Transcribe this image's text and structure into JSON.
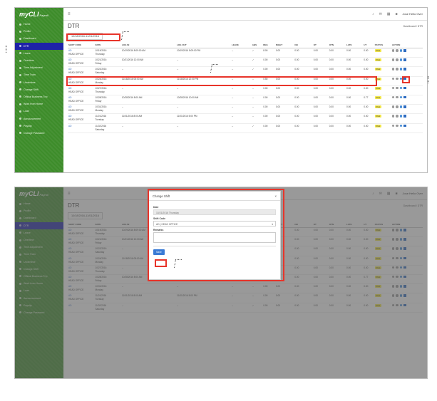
{
  "app": {
    "logo_text": "myCLI",
    "logo_sub": "Payroll",
    "user_name": "Jose Hello Over"
  },
  "sidebar": {
    "items": [
      {
        "label": "Home"
      },
      {
        "label": "Profile"
      },
      {
        "label": "Dashboard"
      },
      {
        "label": "DTR"
      },
      {
        "label": "Leave"
      },
      {
        "label": "Overtime"
      },
      {
        "label": "Time Adjustment"
      },
      {
        "label": "Time Train"
      },
      {
        "label": "Undertime"
      },
      {
        "label": "Change Shift"
      },
      {
        "label": "Official Business Trip"
      },
      {
        "label": "Work from Home"
      },
      {
        "label": "Loan"
      },
      {
        "label": "Announcement"
      },
      {
        "label": "Payslip"
      },
      {
        "label": "Change Password"
      }
    ]
  },
  "page": {
    "title": "DTR",
    "breadcrumb": "Dashboard / DTR",
    "date_range": "10/18/2016-11/01/2016"
  },
  "table": {
    "headers": [
      "SHIFT CODE",
      "DATE",
      "LOG IN",
      "LOG OUT",
      "LEAVE",
      "ABS",
      "REG",
      "NIGHT",
      "OB",
      "OT",
      "OTN",
      "LATE",
      "UT",
      "STATUS",
      "ACTION"
    ],
    "rows": [
      {
        "shift": "AD",
        "office": "HEAD OFFICE",
        "date": "10/19/2016",
        "day": "Thursday",
        "login": "10/19/2016 8:09:00 AM",
        "login_pink": true,
        "logout": "10/19/2016 5:09:00 PM",
        "logout_pink": true,
        "leave": "--",
        "abs": "✓",
        "reg": "8.00",
        "night": "0.00",
        "ob": "0.00",
        "ot": "0.00",
        "otn": "0.00",
        "late": "0.00",
        "ut": "0.00",
        "status": "Post"
      },
      {
        "shift": "AD",
        "office": "HEAD OFFICE",
        "date": "10/21/2016",
        "day": "Friday",
        "login": "10/21/2016 12:00 AM",
        "login_pink": false,
        "logout": "--",
        "logout_pink": false,
        "leave": "--",
        "abs": "✓",
        "reg": "0.00",
        "night": "0.00",
        "ob": "0.00",
        "ot": "0.00",
        "otn": "0.00",
        "late": "0.00",
        "ut": "0.00",
        "status": "Post"
      },
      {
        "shift": "AD",
        "office": "HEAD OFFICE",
        "date": "10/22/2016",
        "day": "Saturday",
        "login": "--",
        "login_pink": false,
        "logout": "--",
        "logout_pink": false,
        "leave": "--",
        "abs": "✓",
        "reg": "0.00",
        "night": "0.00",
        "ob": "0.00",
        "ot": "0.00",
        "otn": "0.00",
        "late": "0.00",
        "ut": "0.00",
        "status": "Post"
      },
      {
        "shift": "AD",
        "office": "HEAD OFFICE",
        "date": "10/24/2016",
        "day": "Monday",
        "login": "11/18/2016 08:00 AM",
        "login_pink": false,
        "logout": "11/18/2016 12:00 PM",
        "logout_pink": false,
        "leave": "--",
        "abs": "--",
        "reg": "0.50",
        "night": "0.00",
        "ob": "0.00",
        "ot": "0.00",
        "otn": "0.00",
        "late": "0.00",
        "ut": "0.00",
        "status": "Post"
      },
      {
        "shift": "AD",
        "office": "HEAD OFFICE",
        "date": "10/27/2016",
        "day": "Thursday",
        "login": "--",
        "login_pink": false,
        "logout": "--",
        "logout_pink": false,
        "leave": "--",
        "abs": "--",
        "reg": "0.00",
        "night": "0.00",
        "ob": "0.00",
        "ot": "0.00",
        "otn": "0.00",
        "late": "0.00",
        "ut": "0.00",
        "status": "Post"
      },
      {
        "shift": "AD",
        "office": "HEAD OFFICE",
        "date": "10/28/2016",
        "day": "Friday",
        "login": "10/28/2016 8:00 AM",
        "login_pink": false,
        "logout": "10/28/2016 10:00 AM",
        "logout_pink": false,
        "leave": "--",
        "abs": "--",
        "reg": "0.00",
        "night": "0.00",
        "ob": "0.00",
        "ot": "0.00",
        "otn": "0.00",
        "late": "0.00",
        "ut": "0.77",
        "status": "Post",
        "ut_red": true
      },
      {
        "shift": "AD",
        "office": "HEAD OFFICE",
        "date": "10/31/2016",
        "day": "Monday",
        "login": "--",
        "login_pink": false,
        "logout": "--",
        "logout_pink": false,
        "leave": "--",
        "abs": "--",
        "reg": "0.00",
        "night": "0.00",
        "ob": "0.00",
        "ot": "0.00",
        "otn": "0.00",
        "late": "0.00",
        "ut": "0.00",
        "status": "Post"
      },
      {
        "shift": "AD",
        "office": "HEAD OFFICE",
        "date": "11/01/2016",
        "day": "Tuesday",
        "login": "11/01/2016 8:00 AM",
        "login_pink": false,
        "logout": "11/01/2016 5:00 PM",
        "logout_pink": false,
        "leave": "--",
        "abs": "--",
        "reg": "0.00",
        "night": "0.00",
        "ob": "0.00",
        "ot": "0.00",
        "otn": "0.00",
        "late": "0.00",
        "ut": "0.00",
        "status": "Post"
      },
      {
        "shift": "AD",
        "office": "",
        "date": "11/02/2016",
        "day": "Saturday",
        "login": "--",
        "login_pink": false,
        "logout": "--",
        "logout_pink": false,
        "leave": "--",
        "abs": "✓",
        "reg": "0.00",
        "night": "0.00",
        "ob": "0.00",
        "ot": "0.00",
        "otn": "0.00",
        "late": "0.00",
        "ut": "0.00",
        "status": "Post"
      }
    ]
  },
  "modal": {
    "title": "Change Shift",
    "close": "×",
    "date_label": "Date",
    "date_value": "10/21/2016 Thursday",
    "shift_label": "Shift Code",
    "shift_value": "AD | HEAD OFFICE",
    "remarks_label": "Remarks",
    "save_label": "Save"
  },
  "colors": {
    "sidebar": "#3d8c2a",
    "active": "#1e22a8",
    "highlight": "#e8342a",
    "badge": "#f2e74b"
  }
}
